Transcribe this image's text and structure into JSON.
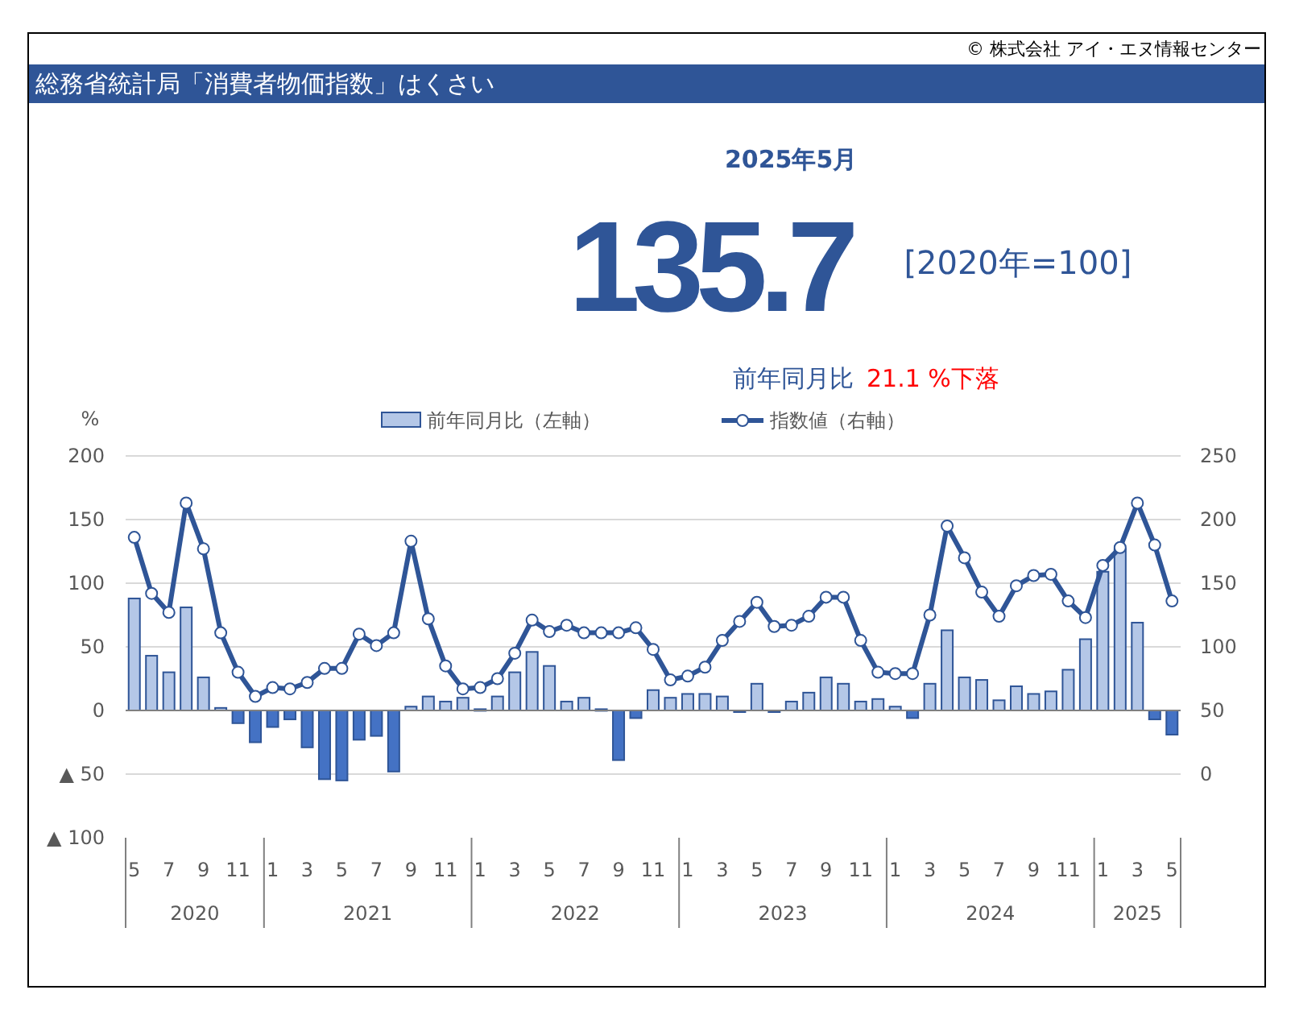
{
  "copyright": "© 株式会社 アイ・エヌ情報センター",
  "title_bar": {
    "title": "総務省統計局「消費者物価指数」はくさい"
  },
  "summary": {
    "period": "2025年5月",
    "value": "135.7",
    "base": "[2020年=100]",
    "change_label": "前年同月比",
    "change_value": "21.1 %下落"
  },
  "chart": {
    "chart_data": {
      "type": "bar",
      "ylabel": "%",
      "ylim": [
        -100,
        200
      ],
      "yticks": [
        {
          "value": 200,
          "label": "200"
        },
        {
          "value": 150,
          "label": "150"
        },
        {
          "value": 100,
          "label": "100"
        },
        {
          "value": 50,
          "label": "50"
        },
        {
          "value": 0,
          "label": "0"
        },
        {
          "value": -50,
          "label": "▲ 50"
        },
        {
          "value": -100,
          "label": "▲ 100"
        }
      ],
      "y2ticks": [
        {
          "value": 250,
          "label": "250"
        },
        {
          "value": 200,
          "label": "200"
        },
        {
          "value": 150,
          "label": "150"
        },
        {
          "value": 100,
          "label": "100"
        },
        {
          "value": 50,
          "label": "50"
        },
        {
          "value": 0,
          "label": "0"
        }
      ],
      "y2lim": [
        0,
        250
      ],
      "grid": true,
      "legend": "top",
      "series": [
        {
          "name": "前年同月比（左軸）",
          "type": "bar",
          "color": "#b4c7e7",
          "values": [
            88,
            43,
            30,
            81,
            26,
            2,
            null,
            null,
            null,
            null,
            null,
            null,
            null,
            null,
            null,
            null,
            3,
            11,
            7,
            10,
            1,
            11,
            30,
            46,
            35,
            7,
            10,
            1,
            null,
            null,
            16,
            10,
            13,
            13,
            11,
            null,
            21,
            null,
            7,
            14,
            26,
            21,
            7,
            9,
            3,
            null,
            21,
            63,
            26,
            24,
            8,
            19,
            13,
            15,
            32,
            56,
            109,
            127,
            69,
            null,
            null
          ]
        },
        {
          "type": "bar",
          "color": "#4472c4",
          "values": [
            null,
            null,
            null,
            null,
            null,
            null,
            -10,
            -25,
            -13,
            -7,
            -29,
            -54,
            -55,
            -23,
            -20,
            -48,
            null,
            null,
            null,
            null,
            null,
            null,
            null,
            null,
            null,
            null,
            null,
            null,
            -39,
            -6,
            null,
            null,
            null,
            null,
            null,
            -1,
            null,
            -1,
            null,
            null,
            null,
            null,
            null,
            null,
            null,
            -6,
            null,
            null,
            null,
            null,
            null,
            null,
            null,
            null,
            null,
            null,
            null,
            null,
            null,
            -7,
            -19
          ]
        },
        {
          "name": "指数値（右軸）",
          "type": "line",
          "axis": "y2",
          "marker": "circle",
          "color": "#2f5597",
          "values": [
            186,
            142,
            127,
            213,
            177,
            111,
            80,
            61,
            68,
            67,
            72,
            83,
            83,
            110,
            101,
            111,
            183,
            122,
            85,
            67,
            68,
            75,
            95,
            121,
            112,
            117,
            111,
            111,
            111,
            115,
            98,
            74,
            77,
            84,
            105,
            120,
            135,
            116,
            117,
            124,
            139,
            139,
            105,
            80,
            79,
            79,
            125,
            195,
            170,
            143,
            124,
            148,
            156,
            157,
            136,
            123,
            164,
            178,
            213,
            180,
            136
          ]
        }
      ]
    },
    "x_groups": [
      {
        "label": "2020",
        "months": [
          "5",
          "7",
          "9",
          "11"
        ]
      },
      {
        "label": "2021",
        "months": [
          "1",
          "3",
          "5",
          "7",
          "9",
          "11"
        ]
      },
      {
        "label": "2022",
        "months": [
          "1",
          "3",
          "5",
          "7",
          "9",
          "11"
        ]
      },
      {
        "label": "2023",
        "months": [
          "1",
          "3",
          "5",
          "7",
          "9",
          "11"
        ]
      },
      {
        "label": "2024",
        "months": [
          "1",
          "3",
          "5",
          "7",
          "9",
          "11"
        ]
      },
      {
        "label": "2025",
        "months": [
          "1",
          "3",
          "5"
        ]
      }
    ]
  }
}
